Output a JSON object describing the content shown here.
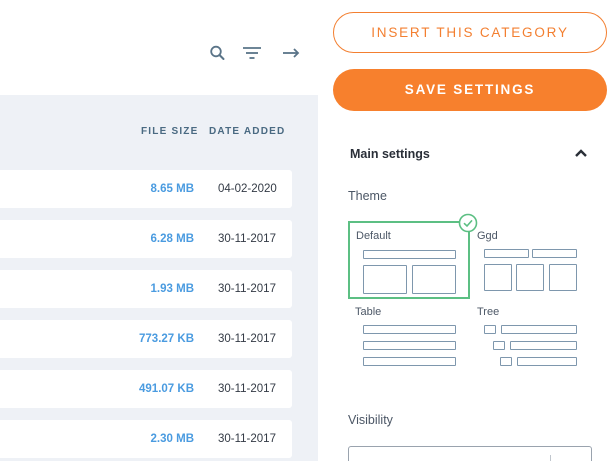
{
  "toolbar": {
    "search_icon": "search-icon",
    "filter_icon": "filter-icon",
    "arrow_icon": "arrow-right-icon"
  },
  "table": {
    "columns": {
      "file_size": "FILE SIZE",
      "date_added": "DATE ADDED"
    },
    "rows": [
      {
        "size": "8.65 MB",
        "date": "04-02-2020"
      },
      {
        "size": "6.28 MB",
        "date": "30-11-2017"
      },
      {
        "size": "1.93 MB",
        "date": "30-11-2017"
      },
      {
        "size": "773.27 KB",
        "date": "30-11-2017"
      },
      {
        "size": "491.07 KB",
        "date": "30-11-2017"
      },
      {
        "size": "2.30 MB",
        "date": "30-11-2017"
      }
    ]
  },
  "settings": {
    "insert_label": "INSERT THIS CATEGORY",
    "save_label": "SAVE SETTINGS",
    "section_title": "Main settings",
    "theme_label": "Theme",
    "themes": [
      "Default",
      "Ggd",
      "Table",
      "Tree"
    ],
    "selected_theme": "Default",
    "visibility_label": "Visibility"
  },
  "colors": {
    "accent": "#f7802d",
    "selected": "#5cbf83",
    "size_text": "#4a9be0"
  }
}
